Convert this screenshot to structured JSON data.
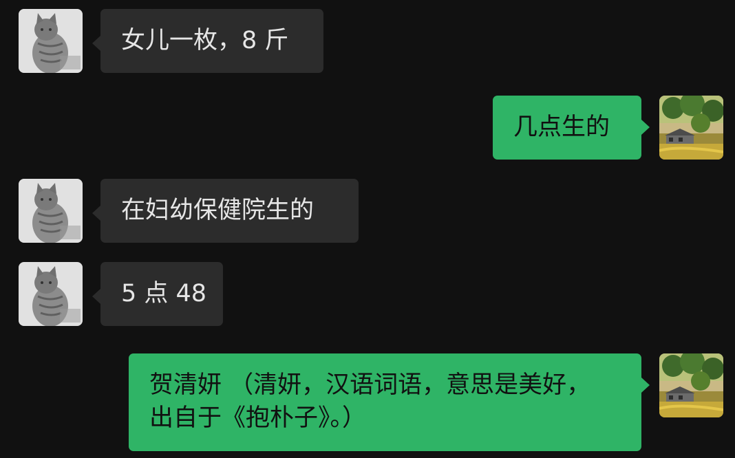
{
  "messages": [
    {
      "side": "left",
      "avatar": "cat-avatar",
      "text": "女儿一枚，8 斤"
    },
    {
      "side": "right",
      "avatar": "landscape-avatar",
      "text": "几点生的"
    },
    {
      "side": "left",
      "avatar": "cat-avatar",
      "text": "在妇幼保健院生的"
    },
    {
      "side": "left",
      "avatar": "cat-avatar",
      "text": "5 点 48"
    },
    {
      "side": "right",
      "avatar": "landscape-avatar",
      "lines": [
        "贺清妍 （清妍，汉语词语，意思是美好，",
        "出自于《抱朴子》。）"
      ]
    }
  ],
  "colors": {
    "background": "#111111",
    "incoming_bubble": "#2c2c2c",
    "outgoing_bubble": "#2fb466"
  }
}
